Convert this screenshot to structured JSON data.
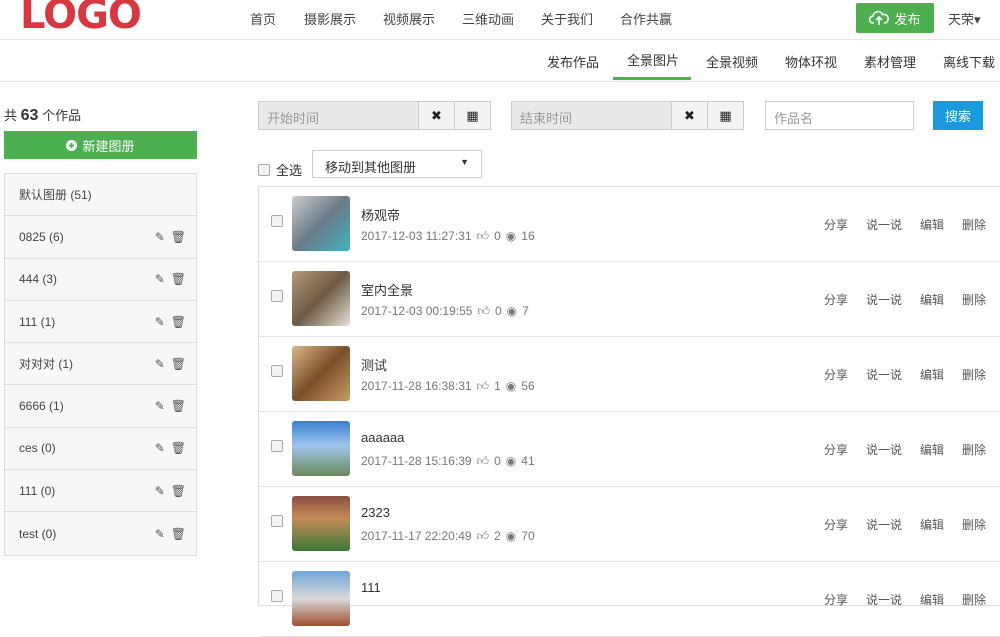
{
  "header": {
    "logo": "LOGO",
    "nav": [
      "首页",
      "摄影展示",
      "视频展示",
      "三维动画",
      "关于我们",
      "合作共赢"
    ],
    "publish": "发布",
    "user": "天荣▾"
  },
  "subnav": [
    "发布作品",
    "全景图片",
    "全景视频",
    "物体环视",
    "素材管理",
    "离线下载"
  ],
  "sidebar": {
    "count_prefix": "共",
    "count": "63",
    "count_suffix": "个作品",
    "new_album": "新建图册",
    "albums": [
      "默认图册 (51)",
      "0825 (6)",
      "444 (3)",
      "111 (1)",
      "对对对 (1)",
      "6666 (1)",
      "ces (0)",
      "111 (0)",
      "test (0)"
    ]
  },
  "filters": {
    "start_placeholder": "开始时间",
    "end_placeholder": "结束时间",
    "name_placeholder": "作品名",
    "search": "搜索",
    "select_all": "全选",
    "move_to": "移动到其他图册"
  },
  "actions": [
    "分享",
    "说一说",
    "编辑",
    "删除"
  ],
  "items": [
    {
      "title": "杨观帝",
      "date": "2017-12-03 11:27:31",
      "likes": "0",
      "views": "16"
    },
    {
      "title": "室内全景",
      "date": "2017-12-03 00:19:55",
      "likes": "0",
      "views": "7"
    },
    {
      "title": "测试",
      "date": "2017-11-28 16:38:31",
      "likes": "1",
      "views": "56"
    },
    {
      "title": "aaaaaa",
      "date": "2017-11-28 15:16:39",
      "likes": "0",
      "views": "41"
    },
    {
      "title": "2323",
      "date": "2017-11-17 22:20:49",
      "likes": "2",
      "views": "70"
    },
    {
      "title": "111",
      "date": "",
      "likes": "",
      "views": ""
    }
  ]
}
